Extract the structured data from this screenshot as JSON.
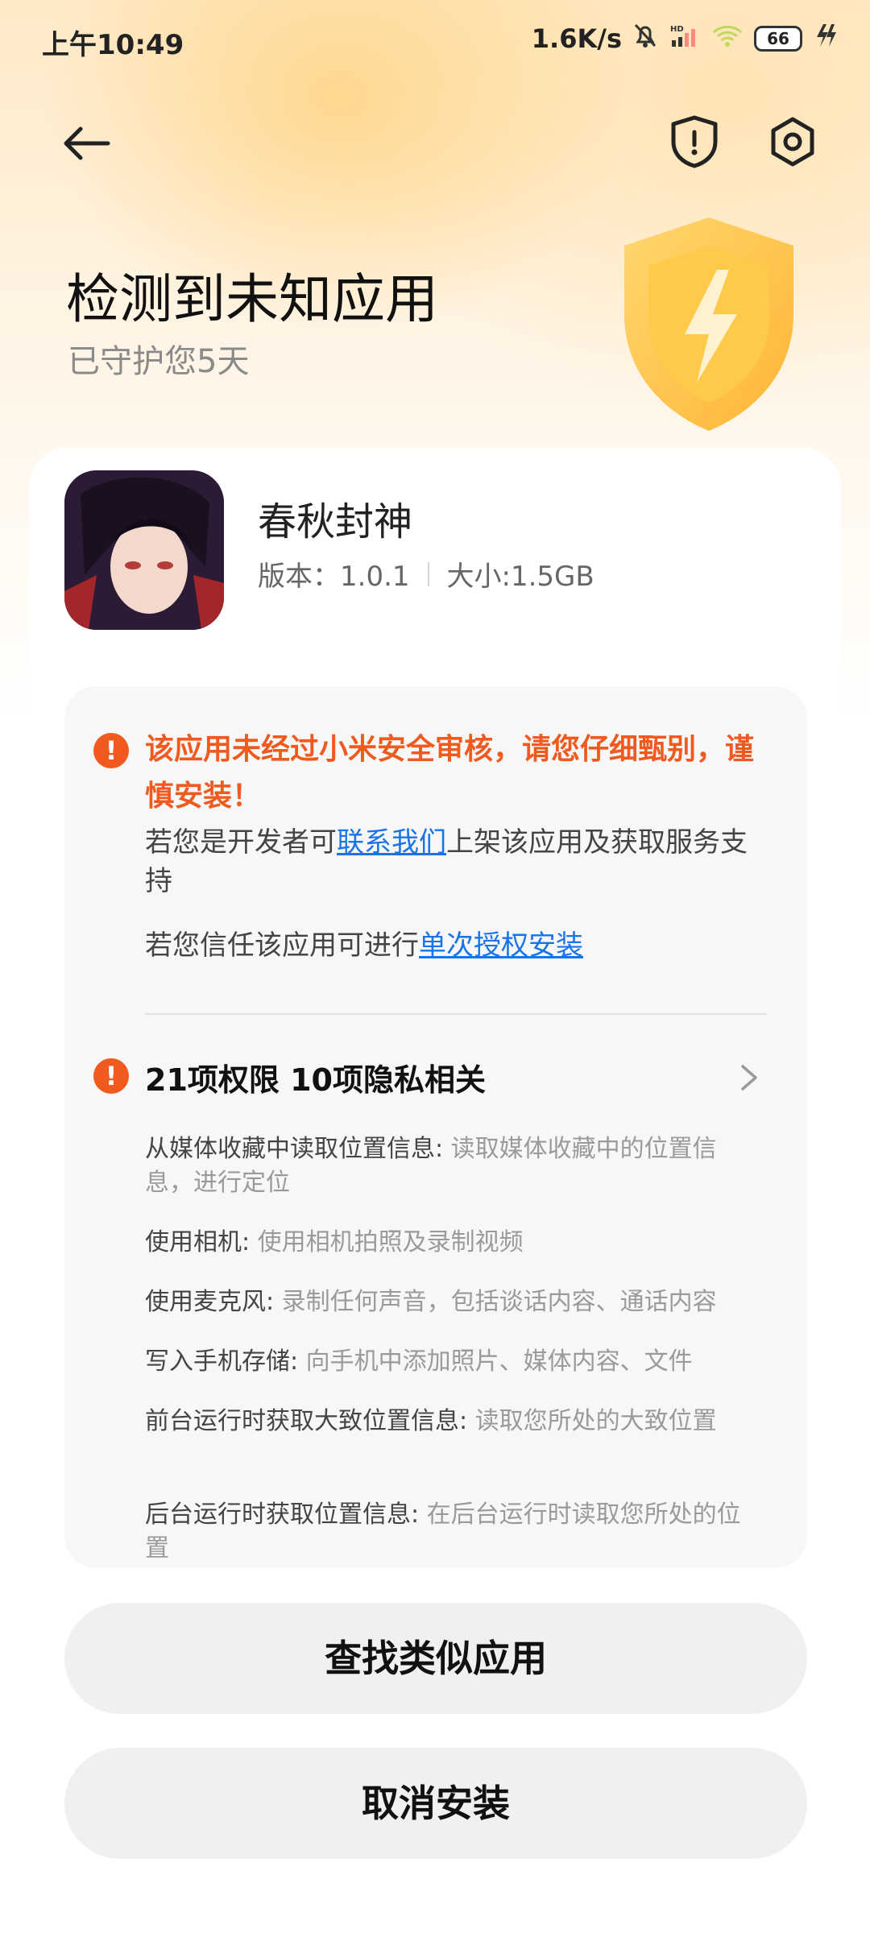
{
  "status_bar": {
    "time": "上午10:49",
    "speed": "1.6K/s",
    "signal_badge": "HD",
    "battery": "66"
  },
  "header": {
    "title": "检测到未知应用",
    "subtitle": "已守护您5天"
  },
  "app": {
    "name": "春秋封神",
    "version": "版本：1.0.1",
    "size": "大小:1.5GB"
  },
  "warning": {
    "headline": "该应用未经过小米安全审核，请您仔细甄别，谨慎安装！",
    "dev_prefix": "若您是开发者可",
    "dev_link": "联系我们",
    "dev_suffix": "上架该应用及获取服务支持",
    "trust_prefix": "若您信任该应用可进行",
    "trust_link": "单次授权安装"
  },
  "permissions": {
    "summary": "21项权限 10项隐私相关",
    "items": [
      {
        "name": "从媒体收藏中读取位置信息:",
        "desc": " 读取媒体收藏中的位置信息，进行定位"
      },
      {
        "name": "使用相机:",
        "desc": " 使用相机拍照及录制视频"
      },
      {
        "name": "使用麦克风:",
        "desc": " 录制任何声音，包括谈话内容、通话内容"
      },
      {
        "name": "写入手机存储:",
        "desc": " 向手机中添加照片、媒体内容、文件"
      },
      {
        "name": "前台运行时获取大致位置信息:",
        "desc": " 读取您所处的大致位置"
      },
      {
        "name": "后台运行时获取位置信息:",
        "desc": " 在后台运行时读取您所处的位置"
      }
    ]
  },
  "buttons": {
    "find_similar": "查找类似应用",
    "cancel_install": "取消安装"
  },
  "colors": {
    "warning": "#f05a1f",
    "link": "#1a73e8",
    "button_bg": "#f0f0f0"
  }
}
